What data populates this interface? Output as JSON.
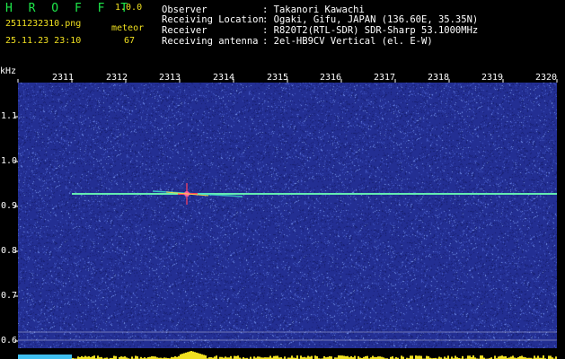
{
  "header": {
    "app_title": "H R O F F T",
    "version": "1.0.0",
    "filename": "2511232310.png",
    "datetime": "25.11.23 23:10",
    "meteor_label": "meteor",
    "meteor_count": "67",
    "info_labels": [
      "Observer",
      "Receiving Location",
      "Receiver",
      "Receiving antenna"
    ],
    "info_values": [
      ": Takanori Kawachi",
      ": Ogaki, Gifu, JAPAN (136.60E, 35.35N)",
      ": R820T2(RTL-SDR) SDR-Sharp 53.1000MHz",
      ": 2el-HB9CV Vertical (el. E-W)"
    ]
  },
  "time_axis": {
    "labels": [
      "2311",
      "2312",
      "2313",
      "2314",
      "2315",
      "2316",
      "2317",
      "2318",
      "2319",
      "2320"
    ]
  },
  "freq_axis": {
    "unit": "kHz",
    "labels": [
      "1.1",
      "1.0",
      "0.9",
      "0.8",
      "0.7",
      "0.6"
    ]
  },
  "colors": {
    "background": "#000000",
    "spectrum": "#232f93",
    "title": "#1ee84a",
    "label": "#f0e020",
    "text": "#ffffff",
    "carrier": "#40e0d0"
  }
}
